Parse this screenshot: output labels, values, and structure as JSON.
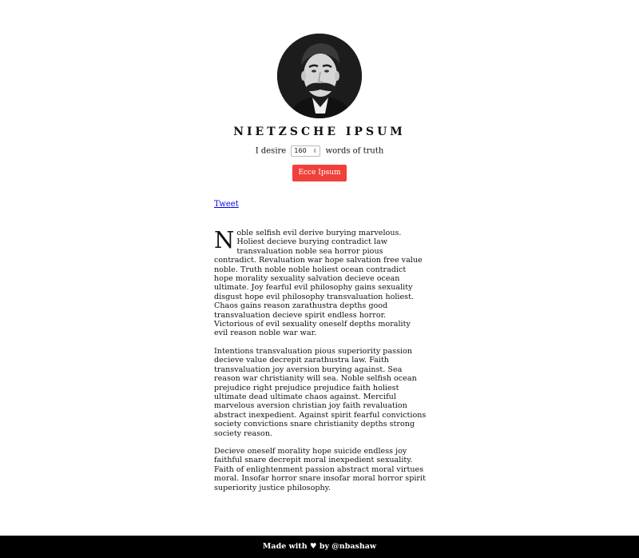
{
  "header": {
    "title": "NIETZSCHE IPSUM"
  },
  "controls": {
    "desire_prefix": "I desire",
    "word_count": "160",
    "stepper_glyph": "⇕",
    "desire_suffix": "words of truth",
    "button_label": "Ecce Ipsum"
  },
  "tweet": {
    "label": "Tweet"
  },
  "content": {
    "drop_cap": "N",
    "paragraphs": [
      "oble selfish evil derive burying marvelous. Holiest decieve burying contradict law transvaluation noble sea horror pious contradict. Revaluation war hope salvation free value noble. Truth noble noble holiest ocean contradict hope morality sexuality salvation decieve ocean ultimate. Joy fearful evil philosophy gains sexuality disgust hope evil philosophy transvaluation holiest. Chaos gains reason zarathustra depths good transvaluation decieve spirit endless horror. Victorious of evil sexuality oneself depths morality evil reason noble war war.",
      "Intentions transvaluation pious superiority passion decieve value decrepit zarathustra law. Faith transvaluation joy aversion burying against. Sea reason war christianity will sea. Noble selfish ocean prejudice right prejudice prejudice faith holiest ultimate dead ultimate chaos against. Merciful marvelous aversion christian joy faith revaluation abstract inexpedient. Against spirit fearful convictions society convictions snare christianity depths strong society reason.",
      "Decieve oneself morality hope suicide endless joy faithful snare decrepit moral inexpedient sexuality. Faith of enlightenment passion abstract moral virtues moral. Insofar horror snare insofar moral horror spirit superiority justice philosophy."
    ]
  },
  "footer": {
    "made_with": "Made with",
    "heart_icon": "♥",
    "by": "by @nbashaw"
  },
  "colors": {
    "button": "#f0403a",
    "footer_bg": "#000000",
    "link": "#0000ee"
  }
}
